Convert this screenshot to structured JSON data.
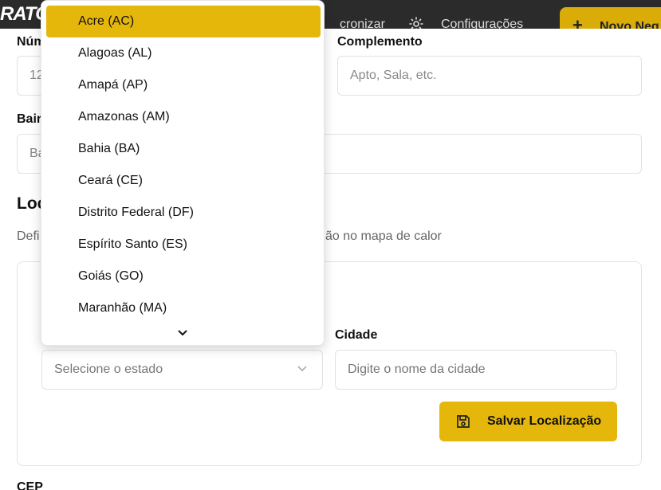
{
  "header": {
    "brand": "RATO",
    "sync_label": "cronizar",
    "settings_label": "Configurações",
    "new_button_label": "Novo Neg"
  },
  "form": {
    "numero_label": "Núm",
    "numero_value": "12",
    "complemento_label": "Complemento",
    "complemento_placeholder": "Apto, Sala, etc.",
    "bairro_label": "Bair",
    "bairro_placeholder": "Ba",
    "cep_label": "CEP"
  },
  "location": {
    "title": "Loc",
    "desc_left": "Defi",
    "desc_right": "ão no mapa de calor",
    "state_placeholder": "Selecione o estado",
    "city_label": "Cidade",
    "city_placeholder": "Digite o nome da cidade",
    "save_label": "Salvar Localização"
  },
  "dropdown": {
    "options": [
      "Acre (AC)",
      "Alagoas (AL)",
      "Amapá (AP)",
      "Amazonas (AM)",
      "Bahia (BA)",
      "Ceará (CE)",
      "Distrito Federal (DF)",
      "Espírito Santo (ES)",
      "Goiás (GO)",
      "Maranhão (MA)"
    ],
    "active_index": 0
  },
  "colors": {
    "accent": "#e6b70b",
    "header_bg": "#2b2b2b"
  }
}
